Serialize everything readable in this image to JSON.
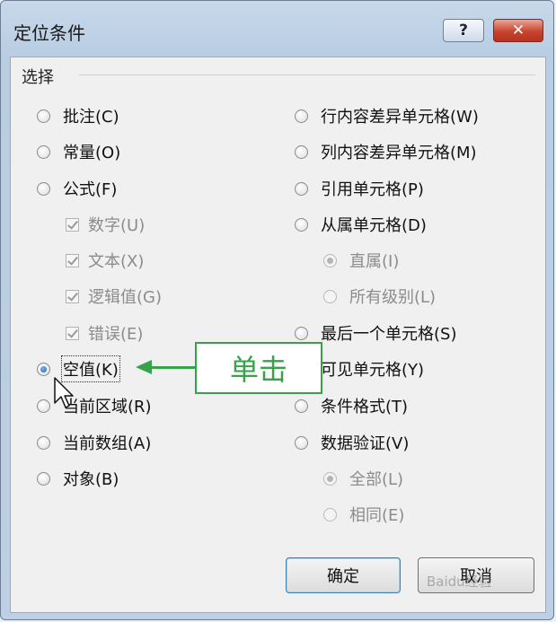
{
  "window": {
    "title": "定位条件",
    "help_label": "?",
    "close_label": "✕"
  },
  "group": {
    "label": "选择"
  },
  "left_options": [
    {
      "label": "批注(C)",
      "type": "radio",
      "checked": false,
      "disabled": false
    },
    {
      "label": "常量(O)",
      "type": "radio",
      "checked": false,
      "disabled": false
    },
    {
      "label": "公式(F)",
      "type": "radio",
      "checked": false,
      "disabled": false
    },
    {
      "label": "数字(U)",
      "type": "checkbox",
      "checked": true,
      "disabled": true
    },
    {
      "label": "文本(X)",
      "type": "checkbox",
      "checked": true,
      "disabled": true
    },
    {
      "label": "逻辑值(G)",
      "type": "checkbox",
      "checked": true,
      "disabled": true
    },
    {
      "label": "错误(E)",
      "type": "checkbox",
      "checked": true,
      "disabled": true
    },
    {
      "label": "空值(K)",
      "type": "radio",
      "checked": true,
      "disabled": false
    },
    {
      "label": "当前区域(R)",
      "type": "radio",
      "checked": false,
      "disabled": false
    },
    {
      "label": "当前数组(A)",
      "type": "radio",
      "checked": false,
      "disabled": false
    },
    {
      "label": "对象(B)",
      "type": "radio",
      "checked": false,
      "disabled": false
    }
  ],
  "right_options": [
    {
      "label": "行内容差异单元格(W)",
      "type": "radio",
      "checked": false,
      "disabled": false
    },
    {
      "label": "列内容差异单元格(M)",
      "type": "radio",
      "checked": false,
      "disabled": false
    },
    {
      "label": "引用单元格(P)",
      "type": "radio",
      "checked": false,
      "disabled": false
    },
    {
      "label": "从属单元格(D)",
      "type": "radio",
      "checked": false,
      "disabled": false
    },
    {
      "label": "直属(I)",
      "type": "radio",
      "checked": true,
      "disabled": true
    },
    {
      "label": "所有级别(L)",
      "type": "radio",
      "checked": false,
      "disabled": true
    },
    {
      "label": "最后一个单元格(S)",
      "type": "radio",
      "checked": false,
      "disabled": false
    },
    {
      "label": "可见单元格(Y)",
      "type": "radio",
      "checked": false,
      "disabled": false
    },
    {
      "label": "条件格式(T)",
      "type": "radio",
      "checked": false,
      "disabled": false
    },
    {
      "label": "数据验证(V)",
      "type": "radio",
      "checked": false,
      "disabled": false
    },
    {
      "label": "全部(L)",
      "type": "radio",
      "checked": true,
      "disabled": true
    },
    {
      "label": "相同(E)",
      "type": "radio",
      "checked": false,
      "disabled": true
    }
  ],
  "buttons": {
    "ok": "确定",
    "cancel": "取消"
  },
  "annotation": {
    "callout": "单击",
    "color": "#37a24a"
  },
  "watermark": "Baidu经验"
}
